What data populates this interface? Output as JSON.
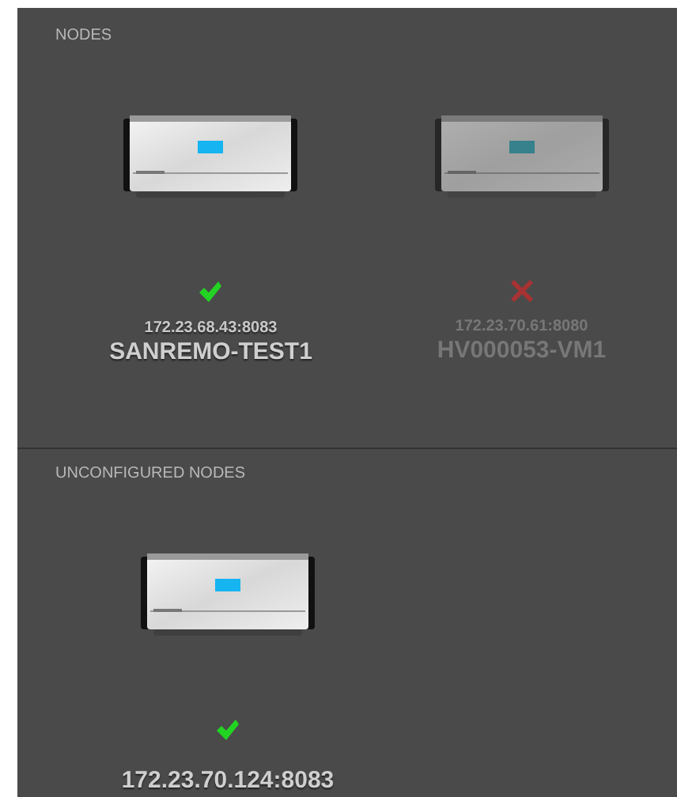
{
  "sections": [
    {
      "title": "NODES",
      "nodes": [
        {
          "address": "172.23.68.43:8083",
          "name": "SANREMO-TEST1",
          "online": true
        },
        {
          "address": "172.23.70.61:8080",
          "name": "HV000053-VM1",
          "online": false
        }
      ]
    },
    {
      "title": "UNCONFIGURED NODES",
      "nodes": [
        {
          "address": "172.23.70.124:8083",
          "online": true
        }
      ]
    }
  ]
}
